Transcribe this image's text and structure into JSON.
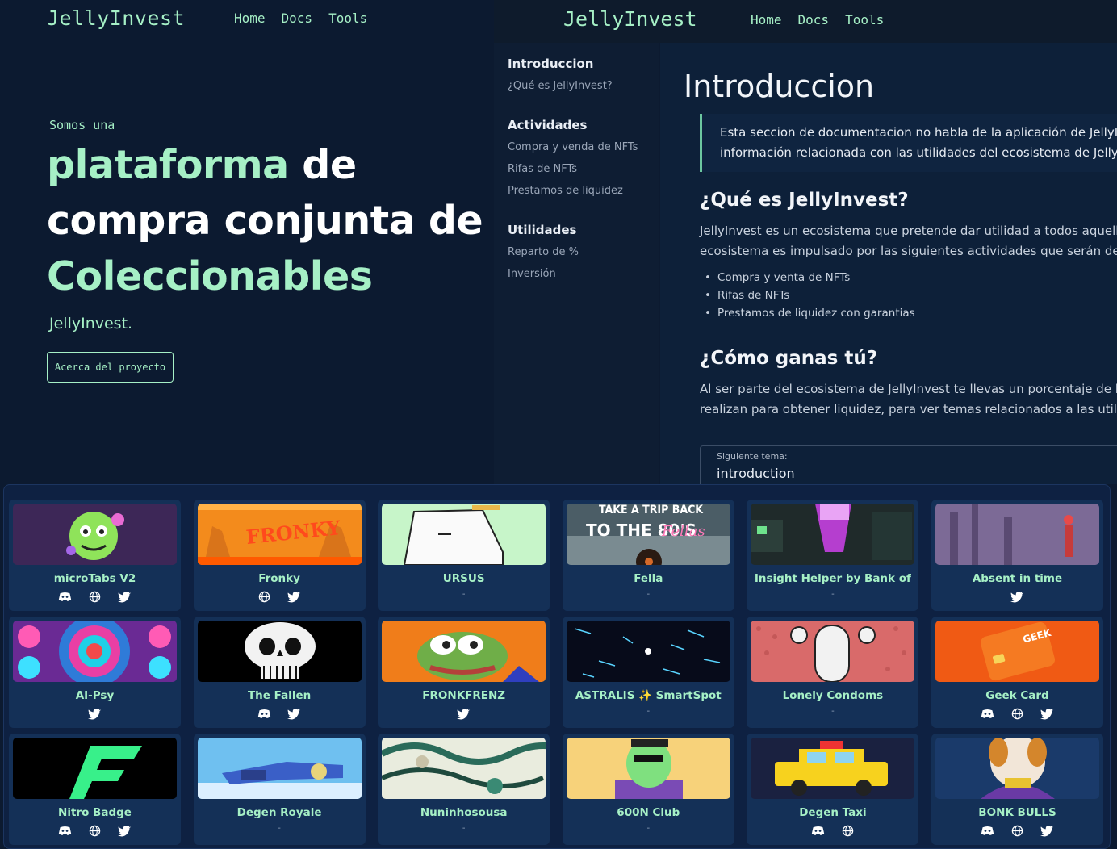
{
  "hero": {
    "logo": "JellyInvest",
    "nav": [
      "Home",
      "Docs",
      "Tools"
    ],
    "intro": "Somos una",
    "headline": {
      "w1": "plataforma",
      "w2": " de",
      "w3": "compra conjunta de",
      "w4": "Coleccionables"
    },
    "brand": "JellyInvest.",
    "about_button": "Acerca del proyecto"
  },
  "docs": {
    "logo": "JellyInvest",
    "nav": [
      "Home",
      "Docs",
      "Tools"
    ],
    "sidebar": [
      {
        "title": "Introduccion",
        "items": [
          "¿Qué es JellyInvest?"
        ]
      },
      {
        "title": "Actividades",
        "items": [
          "Compra y venda de NFTs",
          "Rifas de NFTs",
          "Prestamos de liquidez"
        ]
      },
      {
        "title": "Utilidades",
        "items": [
          "Reparto de %",
          "Inversión"
        ]
      }
    ],
    "title": "Introduccion",
    "callout": [
      "Esta seccion de documentacion no habla de la aplicación de JellyIn",
      "información relacionada con las utilidades del ecosistema de JellyI"
    ],
    "h_what": "¿Qué es JellyInvest?",
    "p_what": [
      "JellyInvest es un ecosistema que pretende dar utilidad a todos aquello",
      "ecosistema es impulsado por las siguientes actividades que serán descr"
    ],
    "bullets": [
      "Compra y venta de NFTs",
      "Rifas de NFTs",
      "Prestamos de liquidez con garantias"
    ],
    "h_how": "¿Cómo ganas tú?",
    "p_how": [
      "Al ser parte del ecosistema de JellyInvest te llevas un porcentaje de la",
      "realizan para obtener liquidez, para ver temas relacionados a las utilida"
    ],
    "next_label": "Siguiente tema:",
    "next_value": "introduction"
  },
  "colors": {
    "accent": "#a6f0c6",
    "bg": "#0c1a30",
    "card": "#143057"
  },
  "cards": [
    {
      "name": "microTabs V2",
      "icons": [
        "discord-icon",
        "globe-icon",
        "twitter-icon"
      ]
    },
    {
      "name": "Fronky",
      "thumb_text": "FRONKY",
      "icons": [
        "globe-icon",
        "twitter-icon"
      ]
    },
    {
      "name": "URSUS",
      "icons": [],
      "dash": "-"
    },
    {
      "name": "Fella",
      "thumb_text": "TAKE A TRIP BACK TO THE 80'S Fellas",
      "icons": [],
      "dash": "-"
    },
    {
      "name": "Insight Helper by Bank of",
      "icons": [],
      "dash": "-"
    },
    {
      "name": "Absent in time",
      "icons": [
        "twitter-icon"
      ]
    },
    {
      "name": "AI-Psy",
      "icons": [
        "twitter-icon"
      ]
    },
    {
      "name": "The Fallen",
      "icons": [
        "discord-icon",
        "twitter-icon"
      ]
    },
    {
      "name": "FRONKFRENZ",
      "icons": [
        "twitter-icon"
      ]
    },
    {
      "name": "ASTRALIS ✨ SmartSpot",
      "icons": [],
      "dash": "-"
    },
    {
      "name": "Lonely Condoms",
      "icons": [],
      "dash": "-"
    },
    {
      "name": "Geek Card",
      "thumb_text": "GEEK",
      "icons": [
        "discord-icon",
        "globe-icon",
        "twitter-icon"
      ]
    },
    {
      "name": "Nitro Badge",
      "icons": [
        "discord-icon",
        "globe-icon",
        "twitter-icon"
      ]
    },
    {
      "name": "Degen Royale",
      "icons": [],
      "dash": "-"
    },
    {
      "name": "Nuninhosousa",
      "icons": [],
      "dash": "-"
    },
    {
      "name": "600N Club",
      "icons": [],
      "dash": "-"
    },
    {
      "name": "Degen Taxi",
      "icons": [
        "discord-icon",
        "globe-icon"
      ]
    },
    {
      "name": "BONK BULLS",
      "icons": [
        "discord-icon",
        "globe-icon",
        "twitter-icon"
      ]
    }
  ]
}
